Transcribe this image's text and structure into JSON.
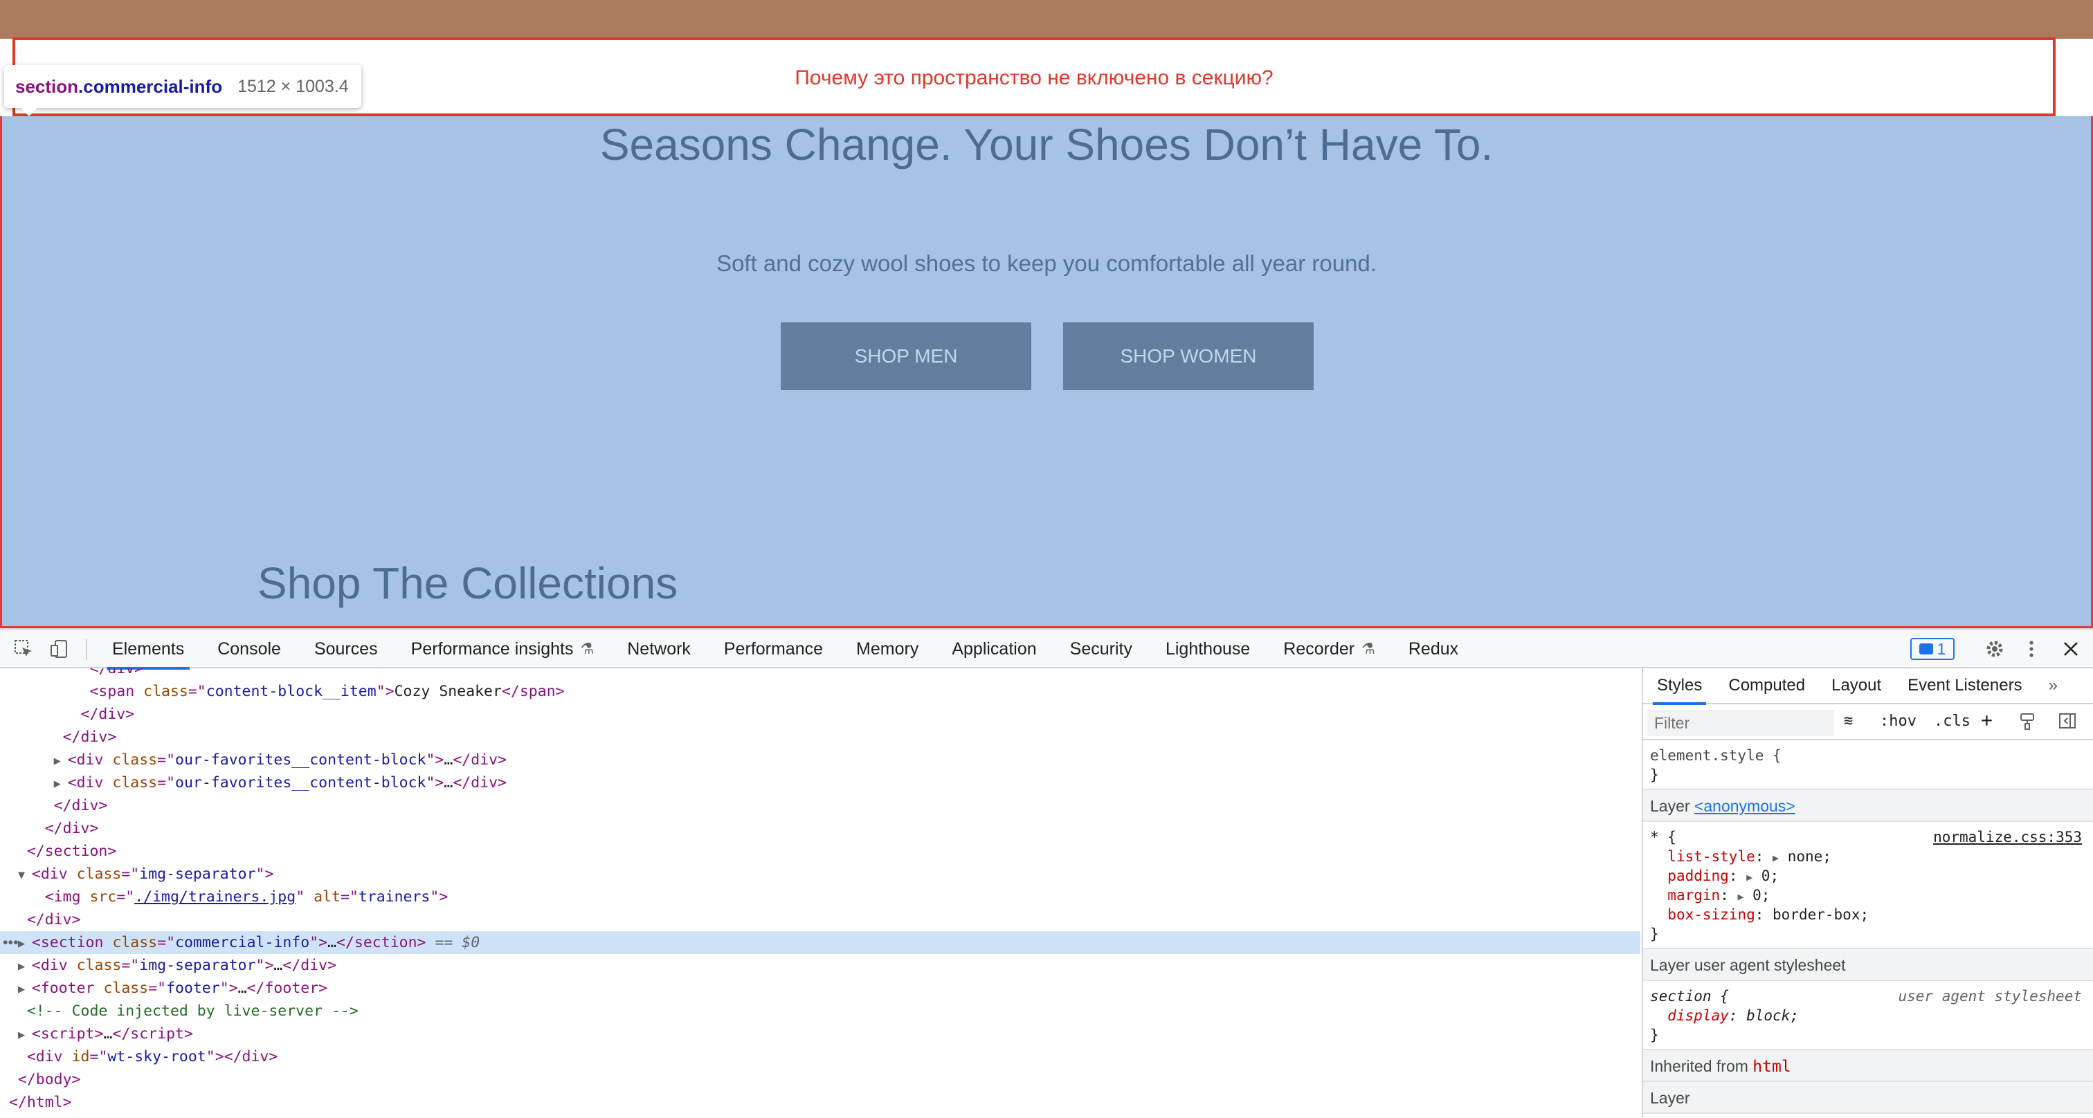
{
  "page": {
    "annotation": "Почему это пространство не включено в секцию?",
    "hero_title": "Seasons Change. Your Shoes Don’t Have To.",
    "hero_subtitle": "Soft and cozy wool shoes to keep you comfortable all year round.",
    "shop_men": "SHOP MEN",
    "shop_women": "SHOP WOMEN",
    "collections_title": "Shop The Collections"
  },
  "tooltip": {
    "tag": "section",
    "class": ".commercial-info",
    "size": "1512 × 1003.4"
  },
  "devtools": {
    "tabs": [
      "Elements",
      "Console",
      "Sources",
      "Performance insights",
      "Network",
      "Performance",
      "Memory",
      "Application",
      "Security",
      "Lighthouse",
      "Recorder",
      "Redux"
    ],
    "issues_count": "1",
    "styles_tabs": [
      "Styles",
      "Computed",
      "Layout",
      "Event Listeners"
    ],
    "filter_placeholder": "Filter",
    "hov": ":hov",
    "cls": ".cls",
    "dom_text": {
      "cozy": "Cozy Sneaker",
      "img_src": "./img/trainers.jpg",
      "comment": "<!-- Code injected by live-server -->",
      "sel_marker": "== $0"
    },
    "styles": {
      "element_style": "element.style {",
      "close": "}",
      "layer1_prefix": "Layer ",
      "layer1_link": "<anonymous>",
      "star_rule": "* {",
      "star_source": "normalize.css:353",
      "props": [
        {
          "name": "list-style",
          "value": "none;"
        },
        {
          "name": "padding",
          "value": "0;"
        },
        {
          "name": "margin",
          "value": "0;"
        },
        {
          "name": "box-sizing",
          "value": "border-box;"
        }
      ],
      "layer2": "Layer user agent stylesheet",
      "section_rule": "section {",
      "ua_source": "user agent stylesheet",
      "display_prop": "display",
      "display_val": "block;",
      "inherited_prefix": "Inherited from ",
      "inherited_tag": "html",
      "layer3": "Layer"
    }
  },
  "colors": {
    "section_overlay": "#a6c3e5",
    "margin_overlay": "#ab7b5e",
    "annotation_red": "#e0382e",
    "button_bg": "#627e9f",
    "accent_blue": "#1a73e8"
  }
}
